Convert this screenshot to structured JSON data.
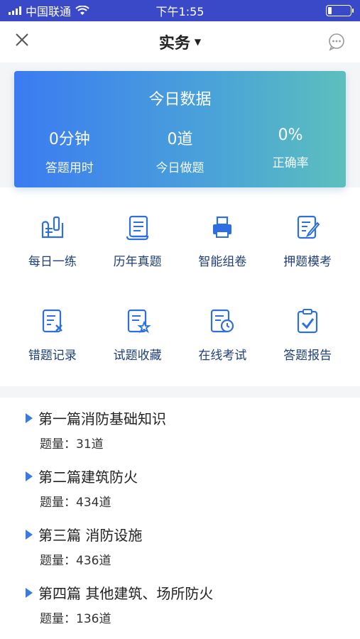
{
  "status_bar": {
    "carrier": "中国联通",
    "time": "下午1:55"
  },
  "nav": {
    "close_icon": "close-icon",
    "title": "实务",
    "message_icon": "chat-bubble-icon"
  },
  "data_card": {
    "title": "今日数据",
    "stats": [
      {
        "value": "0分钟",
        "label": "答题用时"
      },
      {
        "value": "0道",
        "label": "今日做题"
      },
      {
        "value": "0%",
        "label": "正确率"
      }
    ]
  },
  "grid": {
    "items": [
      {
        "label": "每日一练",
        "icon": "daily-practice-icon"
      },
      {
        "label": "历年真题",
        "icon": "scroll-icon"
      },
      {
        "label": "智能组卷",
        "icon": "printer-icon"
      },
      {
        "label": "押题模考",
        "icon": "edit-document-icon"
      },
      {
        "label": "错题记录",
        "icon": "wrong-answer-icon"
      },
      {
        "label": "试题收藏",
        "icon": "favorite-document-icon"
      },
      {
        "label": "在线考试",
        "icon": "timer-document-icon"
      },
      {
        "label": "答题报告",
        "icon": "report-check-icon"
      }
    ]
  },
  "sections": [
    {
      "title": "第一篇消防基础知识",
      "count": "题量：31道"
    },
    {
      "title": "第二篇建筑防火",
      "count": "题量：434道"
    },
    {
      "title": "第三篇 消防设施",
      "count": "题量：436道"
    },
    {
      "title": "第四篇 其他建筑、场所防火",
      "count": "题量：136道"
    }
  ],
  "colors": {
    "status_bar": "#3a49c8",
    "card_gradient_start": "#3b7bf2",
    "card_gradient_end": "#5dbfbd",
    "icon_blue": "#2d6fe0",
    "label_navy": "#1f3f7a"
  }
}
